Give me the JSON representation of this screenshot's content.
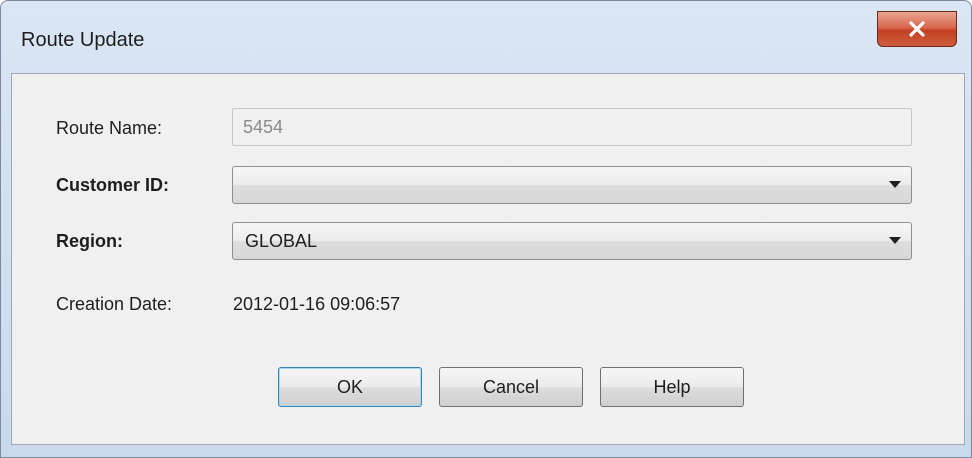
{
  "window": {
    "title": "Route Update",
    "close_glyph": "X"
  },
  "form": {
    "route_name": {
      "label": "Route Name:",
      "value": "5454"
    },
    "customer_id": {
      "label": "Customer ID:",
      "value": ""
    },
    "region": {
      "label": "Region:",
      "value": "GLOBAL"
    },
    "creation_date": {
      "label": "Creation Date:",
      "value": "2012-01-16 09:06:57"
    }
  },
  "buttons": {
    "ok": "OK",
    "cancel": "Cancel",
    "help": "Help"
  },
  "colors": {
    "close_button": "#c9472a",
    "client_bg": "#f0f0f0",
    "default_button_border": "#3c7fb1"
  },
  "icons": {
    "close": "close-icon",
    "dropdown": "chevron-down-icon"
  }
}
